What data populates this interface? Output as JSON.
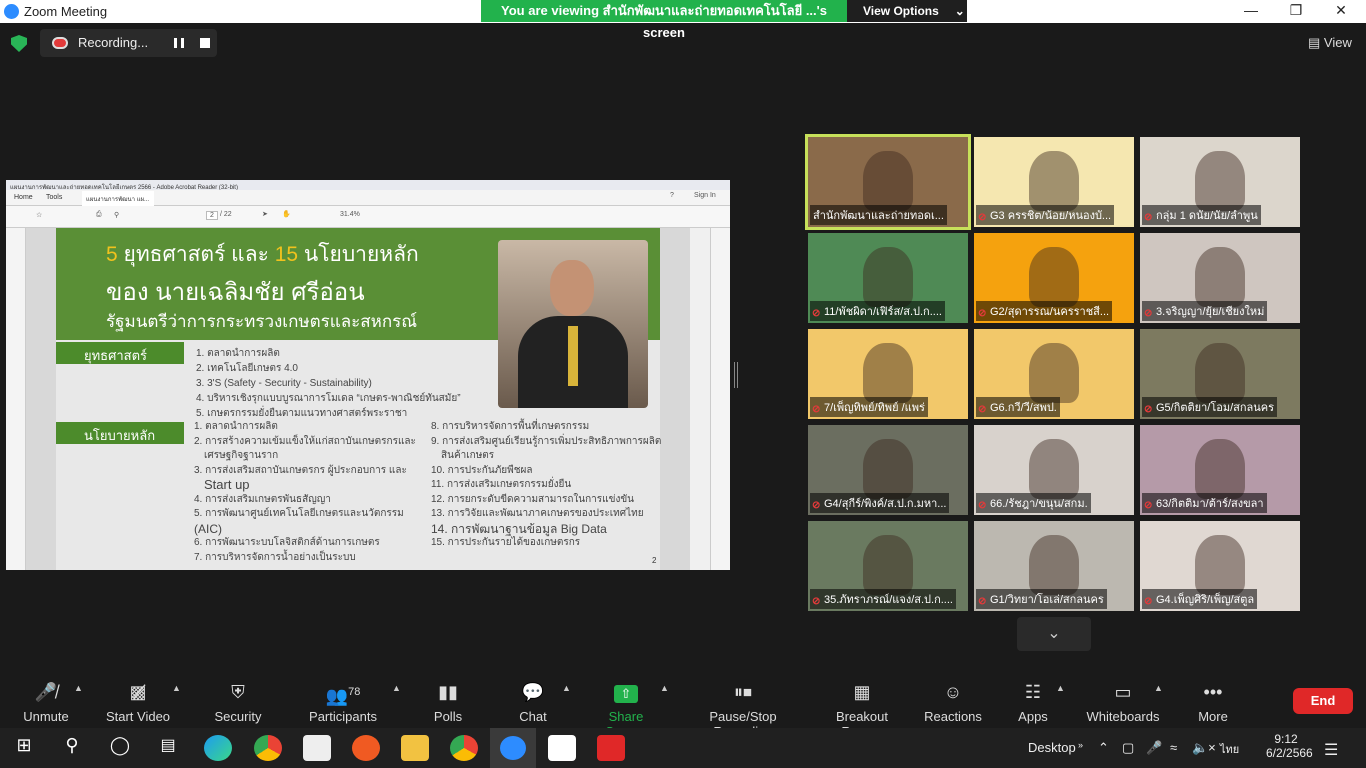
{
  "window": {
    "title": "Zoom Meeting"
  },
  "banner": {
    "message": "You are viewing สำนักพัฒนาและถ่ายทอดเทคโนโลยี ...'s screen",
    "options_label": "View Options"
  },
  "recording": {
    "label": "Recording..."
  },
  "view_label": "View",
  "shared": {
    "app_title": "แผนงานการพัฒนาและถ่ายทอดเทคโนโลยีเกษตร 2566 - Adobe Acrobat Reader (32-bit)",
    "menu": [
      "Home",
      "Tools"
    ],
    "tab": "แผนงานการพัฒนา แผ...",
    "sign_in": "Sign In",
    "page_indicator": "2",
    "page_total": "/ 22",
    "zoom": "31.4%",
    "slide": {
      "line1_pre": "5",
      "line1_mid": " ยุทธศาสตร์ และ ",
      "line1_num": "15",
      "line1_post": " นโยบายหลัก",
      "line2": "ของ นายเฉลิมชัย ศรีอ่อน",
      "line3": "รัฐมนตรีว่าการกระทรวงเกษตรและสหกรณ์",
      "strategy_label": "ยุทธศาสตร์",
      "strategies": [
        "1. ตลาดนำการผลิต",
        "2. เทคโนโลยีเกษตร 4.0",
        "3. 3'S (Safety - Security - Sustainability)",
        "4. บริหารเชิงรุกแบบบูรณาการโมเดล “เกษตร-พาณิชย์ทันสมัย”",
        "5. เกษตรกรรมยั่งยืนตามแนวทางศาสตร์พระราชา"
      ],
      "policy_label": "นโยบายหลัก",
      "policies_left": [
        "1. ตลาดนำการผลิต",
        "2. การสร้างความเข้มแข็งให้แก่สถาบันเกษตรกรและ",
        "เศรษฐกิจฐานราก",
        "3. การส่งเสริมสถาบันเกษตรกร ผู้ประกอบการ และ",
        "Start up",
        "4. การส่งเสริมเกษตรพันธสัญญา",
        "5. การพัฒนาศูนย์เทคโนโลยีเกษตรและนวัตกรรม",
        "(AIC)",
        "6. การพัฒนาระบบโลจิสติกส์ด้านการเกษตร",
        "7. การบริหารจัดการน้ำอย่างเป็นระบบ"
      ],
      "policies_right": [
        "8. การบริหารจัดการพื้นที่เกษตรกรรม",
        "9. การส่งเสริมศูนย์เรียนรู้การเพิ่มประสิทธิภาพการผลิต",
        "สินค้าเกษตร",
        "10. การประกันภัยพืชผล",
        "11. การส่งเสริมเกษตรกรรมยั่งยืน",
        "12. การยกระดับขีดความสามารถในการแข่งขัน",
        "13. การวิจัยและพัฒนาภาคเกษตรของประเทศไทย",
        "14. การพัฒนาฐานข้อมูล Big Data",
        "15. การประกันรายได้ของเกษตรกร"
      ],
      "page_number": "2"
    }
  },
  "tiles": [
    {
      "name": "สำนักพัฒนาและถ่ายทอดเ...",
      "muted": false,
      "bg": "#8a6a4a"
    },
    {
      "name": "G3 ครรชิต/น้อย/หนองบั...",
      "muted": true,
      "bg": "#f5e7b0"
    },
    {
      "name": "กลุ่ม 1 ดนัย/นัย/ลำพูน",
      "muted": true,
      "bg": "#dcd6cc"
    },
    {
      "name": "11/พัชผิดา/เฟิร์ส/ส.ป.ก....",
      "muted": true,
      "bg": "#4f8a55"
    },
    {
      "name": "G2/สุดารรณ/นครราชสี...",
      "muted": true,
      "bg": "#f5a20e"
    },
    {
      "name": "3.จริญญา/ยุ้ย/เชียงใหม่",
      "muted": true,
      "bg": "#cfc6c0"
    },
    {
      "name": "7/เพ็ญทิพย์/ทิพย์ /แพร่",
      "muted": true,
      "bg": "#f2c86a"
    },
    {
      "name": "G6.กวี/วี/สพป.",
      "muted": true,
      "bg": "#f2c86a"
    },
    {
      "name": "G5/กิตติยา/โอม/สกลนคร",
      "muted": true,
      "bg": "#7d7a60"
    },
    {
      "name": "G4/สุกีร์/พิงค์/ส.ป.ก.มหา...",
      "muted": true,
      "bg": "#6b6e60"
    },
    {
      "name": "66./รัชฎา/ขนุน/สกม.",
      "muted": true,
      "bg": "#d8d2cc"
    },
    {
      "name": "63/กิตติมา/ต้าร์/สงขลา",
      "muted": true,
      "bg": "#b59aa8"
    },
    {
      "name": "35.ภัทราภรณ์/แจง/ส.ป.ก....",
      "muted": true,
      "bg": "#6a7a60"
    },
    {
      "name": "G1/วิทยา/โอเล่/สกลนคร",
      "muted": true,
      "bg": "#bcb8b0"
    },
    {
      "name": "G4.เพ็ญศิริ/เพ็ญ/สตูล",
      "muted": true,
      "bg": "#e0d8d2"
    }
  ],
  "toolbar": {
    "unmute": "Unmute",
    "start_video": "Start Video",
    "security": "Security",
    "participants": "Participants",
    "participants_count": "78",
    "polls": "Polls",
    "chat": "Chat",
    "share_screen": "Share Screen",
    "pause_recording": "Pause/Stop Recording",
    "breakout": "Breakout Rooms",
    "reactions": "Reactions",
    "apps": "Apps",
    "whiteboards": "Whiteboards",
    "more": "More",
    "end": "End"
  },
  "taskbar": {
    "desktop": "Desktop",
    "lang": "ไทย",
    "time": "9:12",
    "date": "6/2/2566"
  },
  "colors": {
    "accent_green": "#22b24c",
    "end_red": "#e02828",
    "active_speaker": "#c7e05a"
  }
}
